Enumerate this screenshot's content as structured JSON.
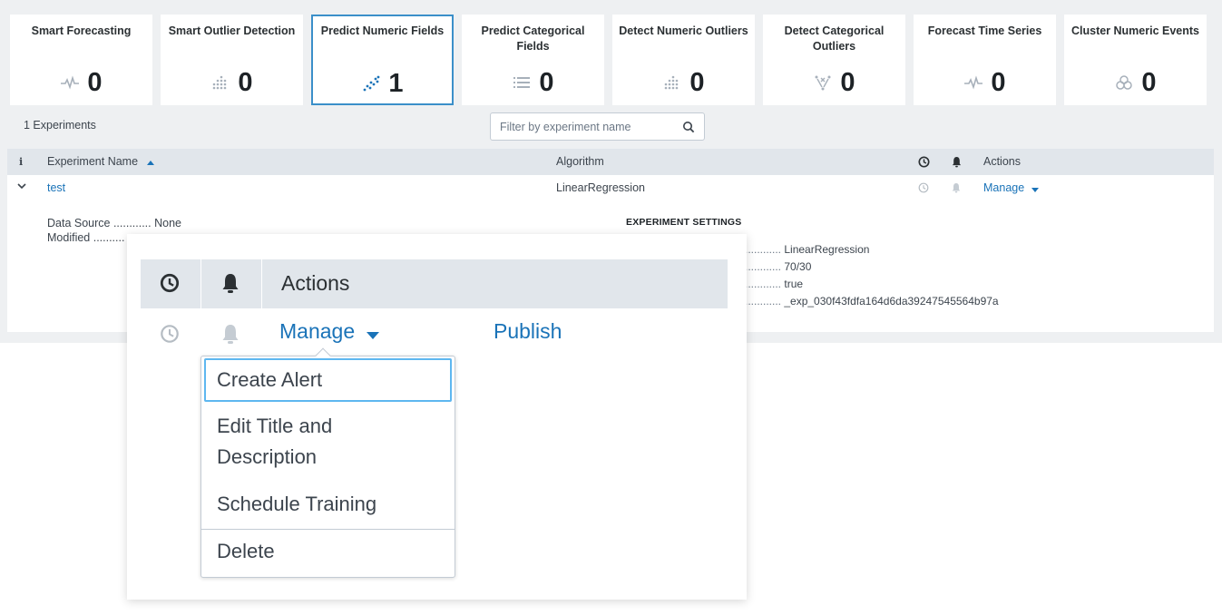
{
  "tiles": [
    {
      "title": "Smart Forecasting",
      "count": "0",
      "icon": "pulse-icon",
      "selected": false
    },
    {
      "title": "Smart Outlier Detection",
      "count": "0",
      "icon": "outlier-dots-icon",
      "selected": false
    },
    {
      "title": "Predict Numeric Fields",
      "count": "1",
      "icon": "scatter-icon",
      "selected": true
    },
    {
      "title": "Predict Categorical Fields",
      "count": "0",
      "icon": "list-icon",
      "selected": false
    },
    {
      "title": "Detect Numeric Outliers",
      "count": "0",
      "icon": "outlier-dots-icon",
      "selected": false
    },
    {
      "title": "Detect Categorical Outliers",
      "count": "0",
      "icon": "categorical-outlier-icon",
      "selected": false
    },
    {
      "title": "Forecast Time Series",
      "count": "0",
      "icon": "pulse-icon",
      "selected": false
    },
    {
      "title": "Cluster Numeric Events",
      "count": "0",
      "icon": "cluster-icon",
      "selected": false
    }
  ],
  "experiments_count": "1 Experiments",
  "filter": {
    "placeholder": "Filter by experiment name"
  },
  "table": {
    "headers": {
      "info": "i",
      "name": "Experiment Name",
      "algorithm": "Algorithm",
      "actions": "Actions"
    },
    "row": {
      "name": "test",
      "algorithm": "LinearRegression",
      "manage": "Manage"
    }
  },
  "details": {
    "data_source_label": "Data Source ............",
    "data_source_value": "None",
    "modified_label": "Modified ..........",
    "settings_title": "EXPERIMENT SETTINGS",
    "settings": [
      {
        "dots": "............",
        "value": "LinearRegression"
      },
      {
        "dots": "............",
        "value": "70/30"
      },
      {
        "dots": "............",
        "value": "true"
      },
      {
        "dots": "............",
        "value": "_exp_030f43fdfa164d6da39247545564b97a"
      }
    ]
  },
  "zoom": {
    "header_actions": "Actions",
    "manage": "Manage",
    "publish": "Publish",
    "menu": [
      "Create Alert",
      "Edit Title and Description",
      "Schedule Training",
      "Delete"
    ]
  },
  "colors": {
    "accent": "#1a73b8",
    "selected_border": "#3b8fc9",
    "focus_border": "#5eb7f0",
    "header_bg": "#e1e6eb",
    "page_bg": "#eef0f2"
  }
}
